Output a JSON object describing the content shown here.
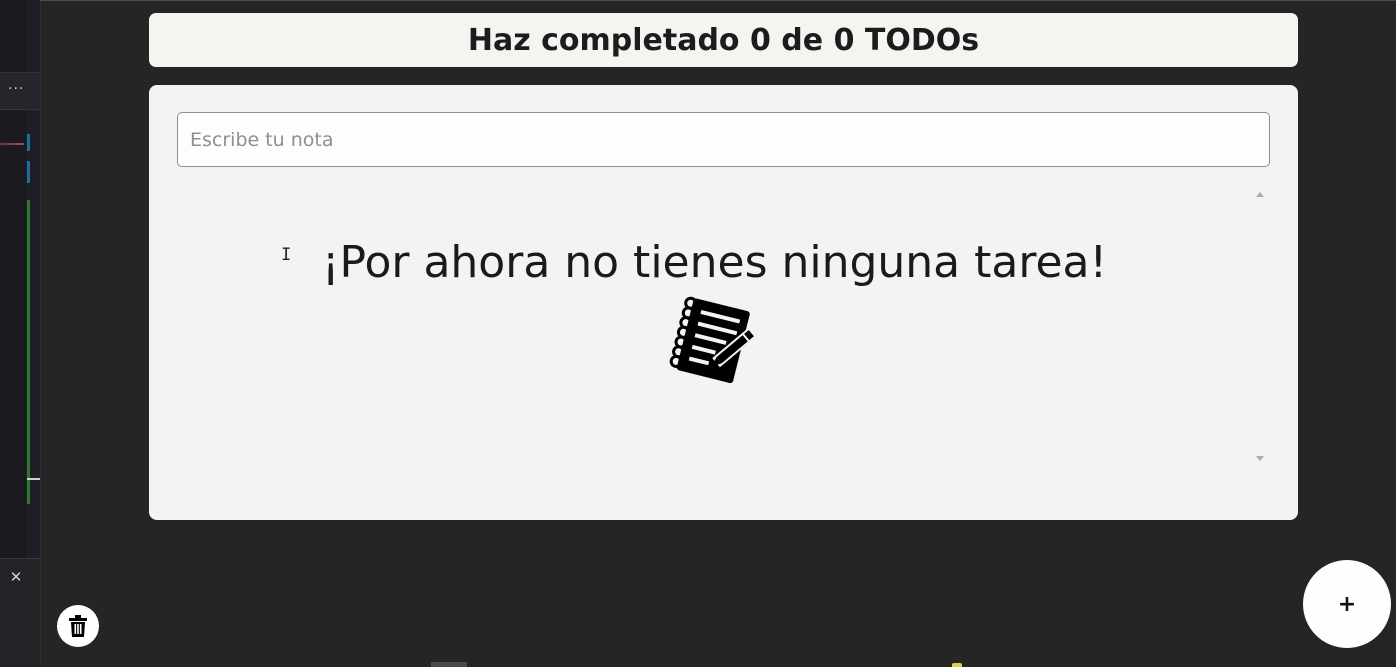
{
  "header": {
    "title": "Haz completado 0 de 0 TODOs"
  },
  "note_input": {
    "placeholder": "Escribe tu nota",
    "value": ""
  },
  "todo_list": {
    "items": [],
    "empty_message": "¡Por ahora no tienes ninguna tarea!",
    "empty_icon": "notepad-pencil-icon"
  },
  "actions": {
    "add_label": "+",
    "add_icon": "plus-icon",
    "delete_icon": "trash-icon"
  },
  "editor_sidebar": {
    "more_icon": "more-horizontal-icon",
    "more_label": "···",
    "close_icon": "close-icon",
    "close_label": "✕"
  },
  "colors": {
    "background": "#252525",
    "card": "#f2f3f4",
    "header_card": "#f4f4f1",
    "text": "#1c1c1c"
  }
}
